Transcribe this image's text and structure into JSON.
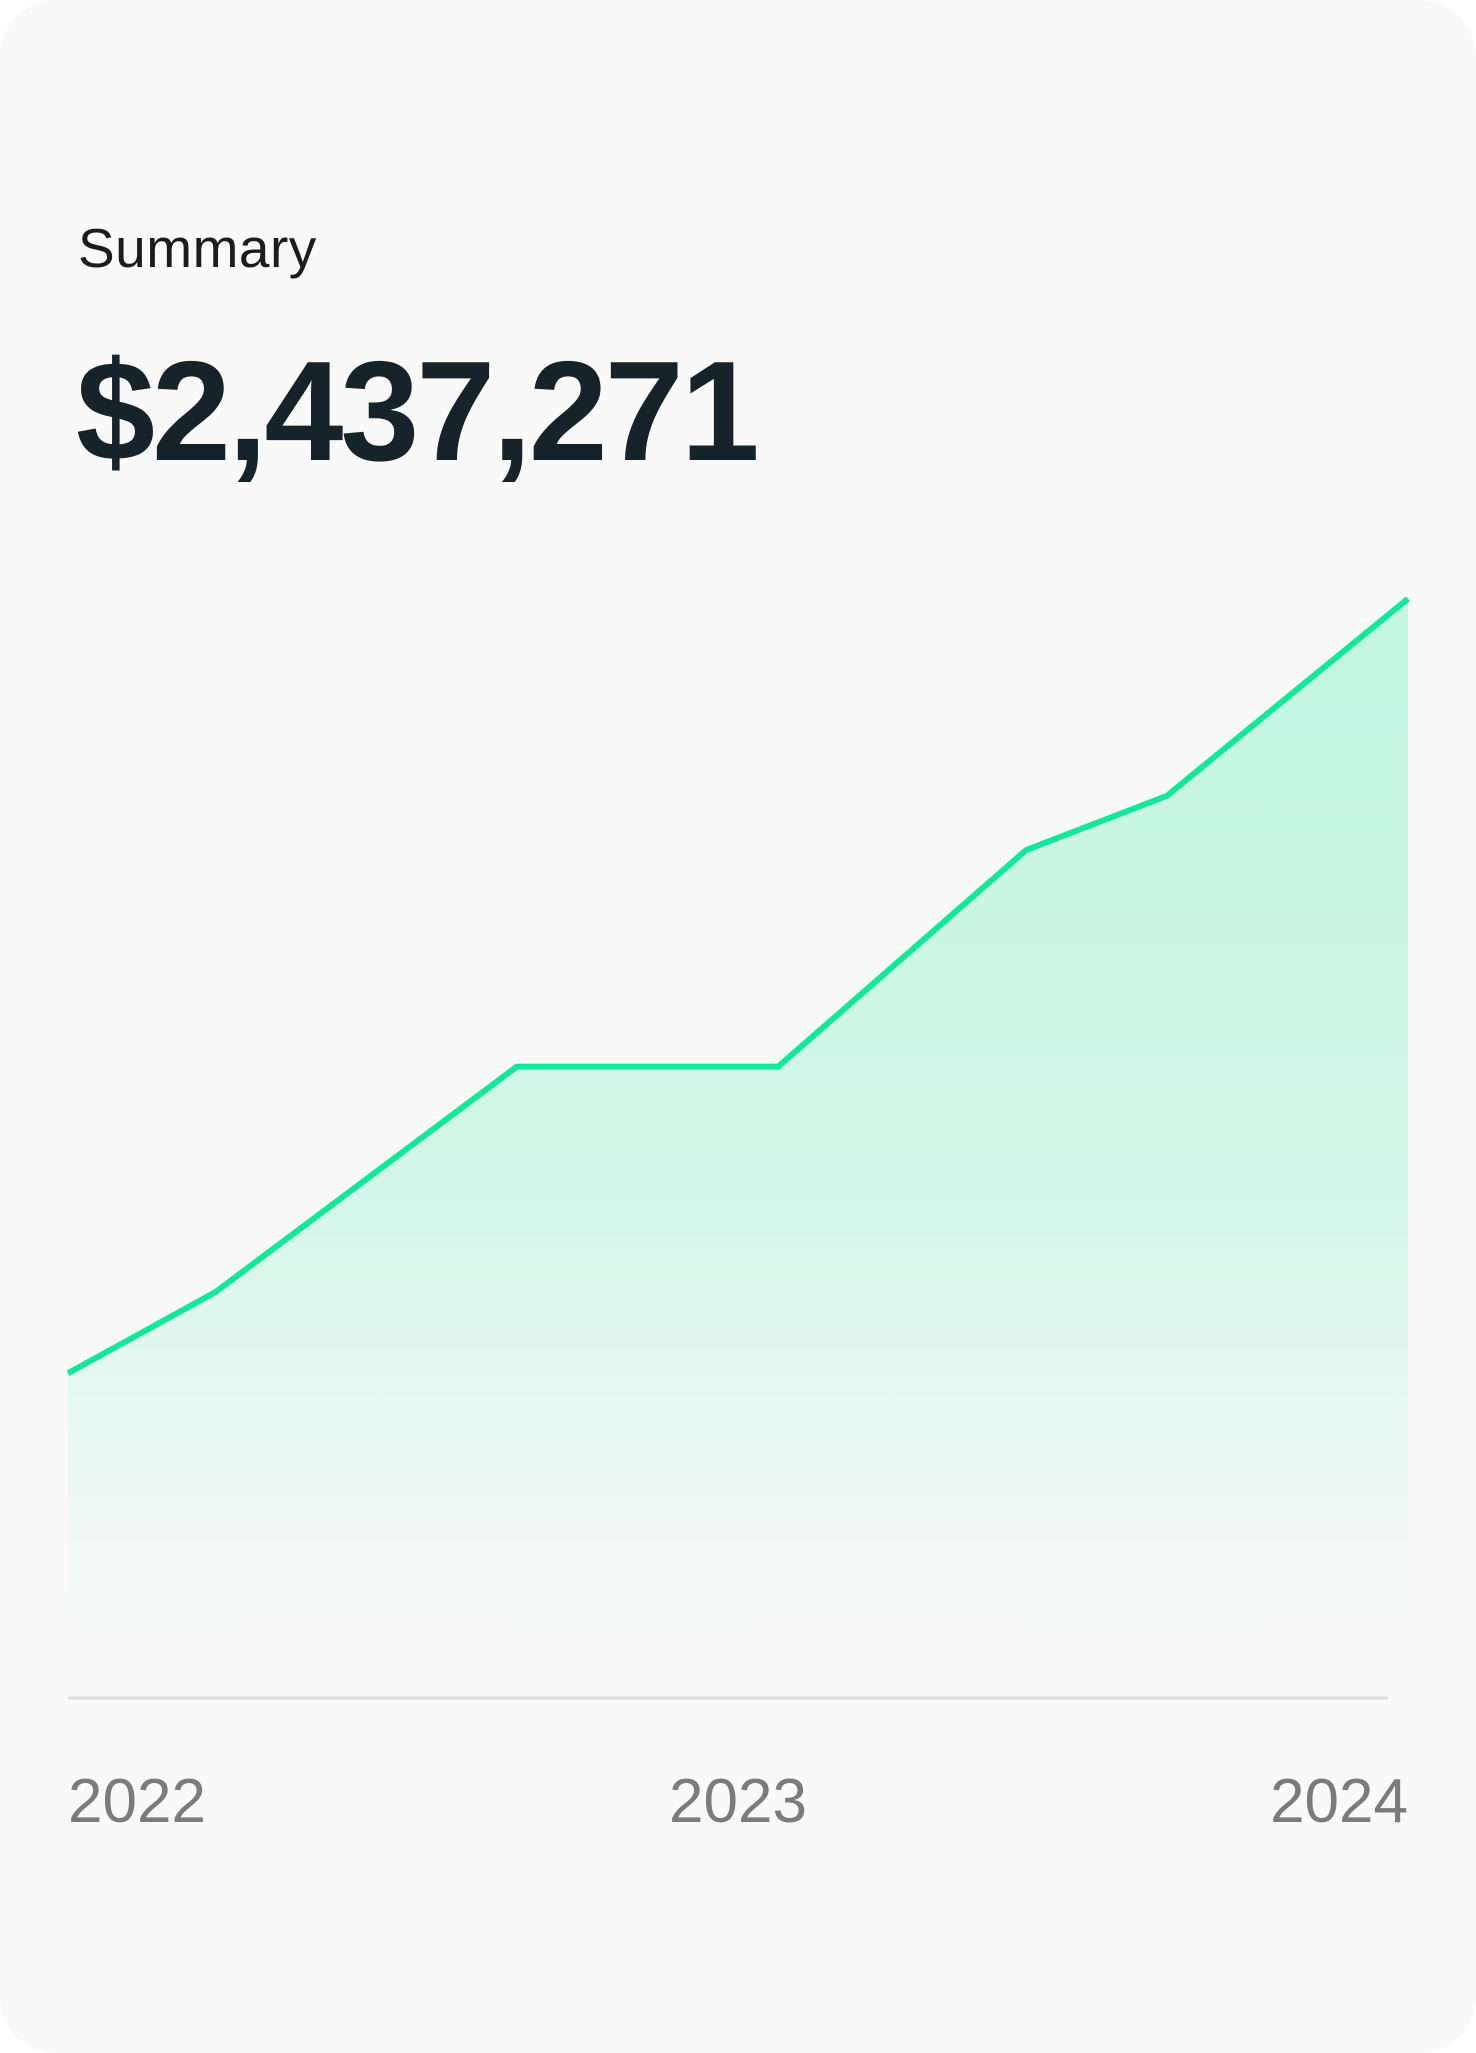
{
  "summary": {
    "label": "Summary",
    "amount": "$2,437,271"
  },
  "colors": {
    "accent": "#13e89a",
    "card": "#f9f9f9",
    "amount": "#16232a",
    "tick": "#7b7b7b",
    "baseline": "#dedede"
  },
  "chart_data": {
    "type": "area",
    "title": "",
    "xlabel": "",
    "ylabel": "",
    "x_ticks": [
      "2022",
      "2023",
      "2024"
    ],
    "x_range": [
      2022,
      2024
    ],
    "grid": false,
    "series": [
      {
        "x": [
          2022,
          2022.22,
          2022.67,
          2023.06,
          2023.43,
          2023.64,
          2024
        ],
        "values": [
          720000,
          900000,
          1400000,
          1400000,
          1880000,
          2000000,
          2437271
        ]
      }
    ],
    "ylim": [
      0,
      2900000
    ]
  }
}
